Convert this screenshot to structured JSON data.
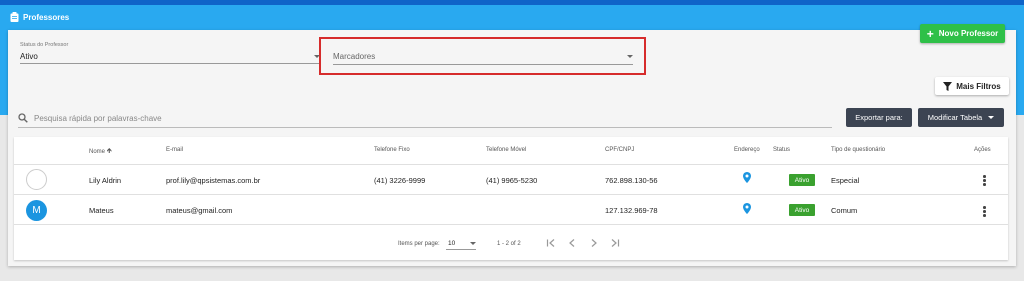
{
  "header": {
    "title": "Professores",
    "icon": "clipboard-icon"
  },
  "actions": {
    "new_label": "Novo Professor",
    "more_filters_label": "Mais Filtros",
    "export_label": "Exportar para:",
    "modify_label": "Modificar Tabela"
  },
  "filters": {
    "status": {
      "label": "Status do Professor",
      "value": "Ativo"
    },
    "markers": {
      "placeholder": "Marcadores"
    }
  },
  "search": {
    "placeholder": "Pesquisa rápida por palavras-chave"
  },
  "table": {
    "columns": {
      "name": "Nome",
      "email": "E-mail",
      "phone": "Telefone Fixo",
      "mobile": "Telefone Móvel",
      "cpf": "CPF/CNPJ",
      "address": "Endereço",
      "status": "Status",
      "type": "Tipo de questionário",
      "actions": "Ações"
    },
    "rows": [
      {
        "avatar": "",
        "name": "Lily Aldrin",
        "email": "prof.lily@qpsistemas.com.br",
        "phone": "(41) 3226-9999",
        "mobile": "(41) 9965-5230",
        "cpf": "762.898.130-56",
        "status": "Ativo",
        "type": "Especial"
      },
      {
        "avatar": "M",
        "name": "Mateus",
        "email": "mateus@gmail.com",
        "phone": "",
        "mobile": "",
        "cpf": "127.132.969-78",
        "status": "Ativo",
        "type": "Comum"
      }
    ]
  },
  "pagination": {
    "items_per_page_label": "Items per page:",
    "items_per_page": "10",
    "range": "1 - 2 of 2"
  },
  "colors": {
    "header_blue": "#29a9f0",
    "top_strip": "#0f64c8",
    "success_green": "#2ec048",
    "badge_green": "#3aa12f",
    "dark_button": "#3c4452",
    "highlight_red": "#d62c2c",
    "pin_blue": "#1b95e0"
  }
}
